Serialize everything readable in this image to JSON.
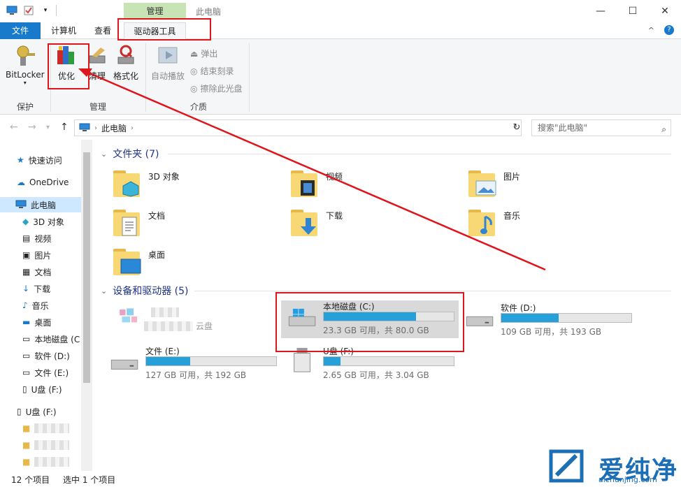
{
  "window": {
    "title": "此电脑",
    "context_tab_group": "管理",
    "minimize": "—",
    "maximize": "☐",
    "close": "✕"
  },
  "ribbon_tabs": {
    "file": "文件",
    "computer": "计算机",
    "view": "查看",
    "drive_tools": "驱动器工具"
  },
  "ribbon": {
    "bitlocker": "BitLocker",
    "optimize": "优化",
    "cleanup": "清理",
    "format": "格式化",
    "autoplay": "自动播放",
    "eject": "弹出",
    "finish_burn": "结束刻录",
    "erase_disc": "擦除此光盘",
    "groups": {
      "protect": "保护",
      "manage": "管理",
      "media": "介质"
    }
  },
  "address": {
    "path": "此电脑",
    "search_placeholder": "搜索\"此电脑\""
  },
  "nav": {
    "quick_access": "快速访问",
    "onedrive": "OneDrive",
    "this_pc": "此电脑",
    "objects3d": "3D 对象",
    "videos": "视频",
    "pictures": "图片",
    "documents": "文档",
    "downloads": "下载",
    "music": "音乐",
    "desktop": "桌面",
    "local_c": "本地磁盘 (C",
    "soft_d": "软件 (D:)",
    "file_e": "文件 (E:)",
    "usb_f": "U盘 (F:)",
    "usb_f2": "U盘 (F:)"
  },
  "folders_section": {
    "title": "文件夹 (7)"
  },
  "folders": {
    "objects3d": "3D 对象",
    "videos": "视频",
    "pictures": "图片",
    "documents": "文档",
    "downloads": "下载",
    "music": "音乐",
    "desktop": "桌面"
  },
  "devices_section": {
    "title": "设备和驱动器 (5)"
  },
  "devices": {
    "cloud_label": "云盘",
    "c": {
      "name": "本地磁盘 (C:)",
      "info": "23.3 GB 可用，共 80.0 GB",
      "used_fraction": 0.71
    },
    "d": {
      "name": "软件 (D:)",
      "info": "109 GB 可用，共 193 GB",
      "used_fraction": 0.44
    },
    "e": {
      "name": "文件 (E:)",
      "info": "127 GB 可用，共 192 GB",
      "used_fraction": 0.34
    },
    "f": {
      "name": "U盘 (F:)",
      "info": "2.65 GB 可用，共 3.04 GB",
      "used_fraction": 0.13
    }
  },
  "status": {
    "count": "12 个项目",
    "selected": "选中 1 个项目"
  },
  "watermark": {
    "brand": "爱纯净",
    "url": "aichunjing.com"
  },
  "colors": {
    "accent": "#1979ca",
    "bar_fill": "#26a0da",
    "highlight": "#e0141b",
    "context_tab": "#c9e4b4"
  }
}
